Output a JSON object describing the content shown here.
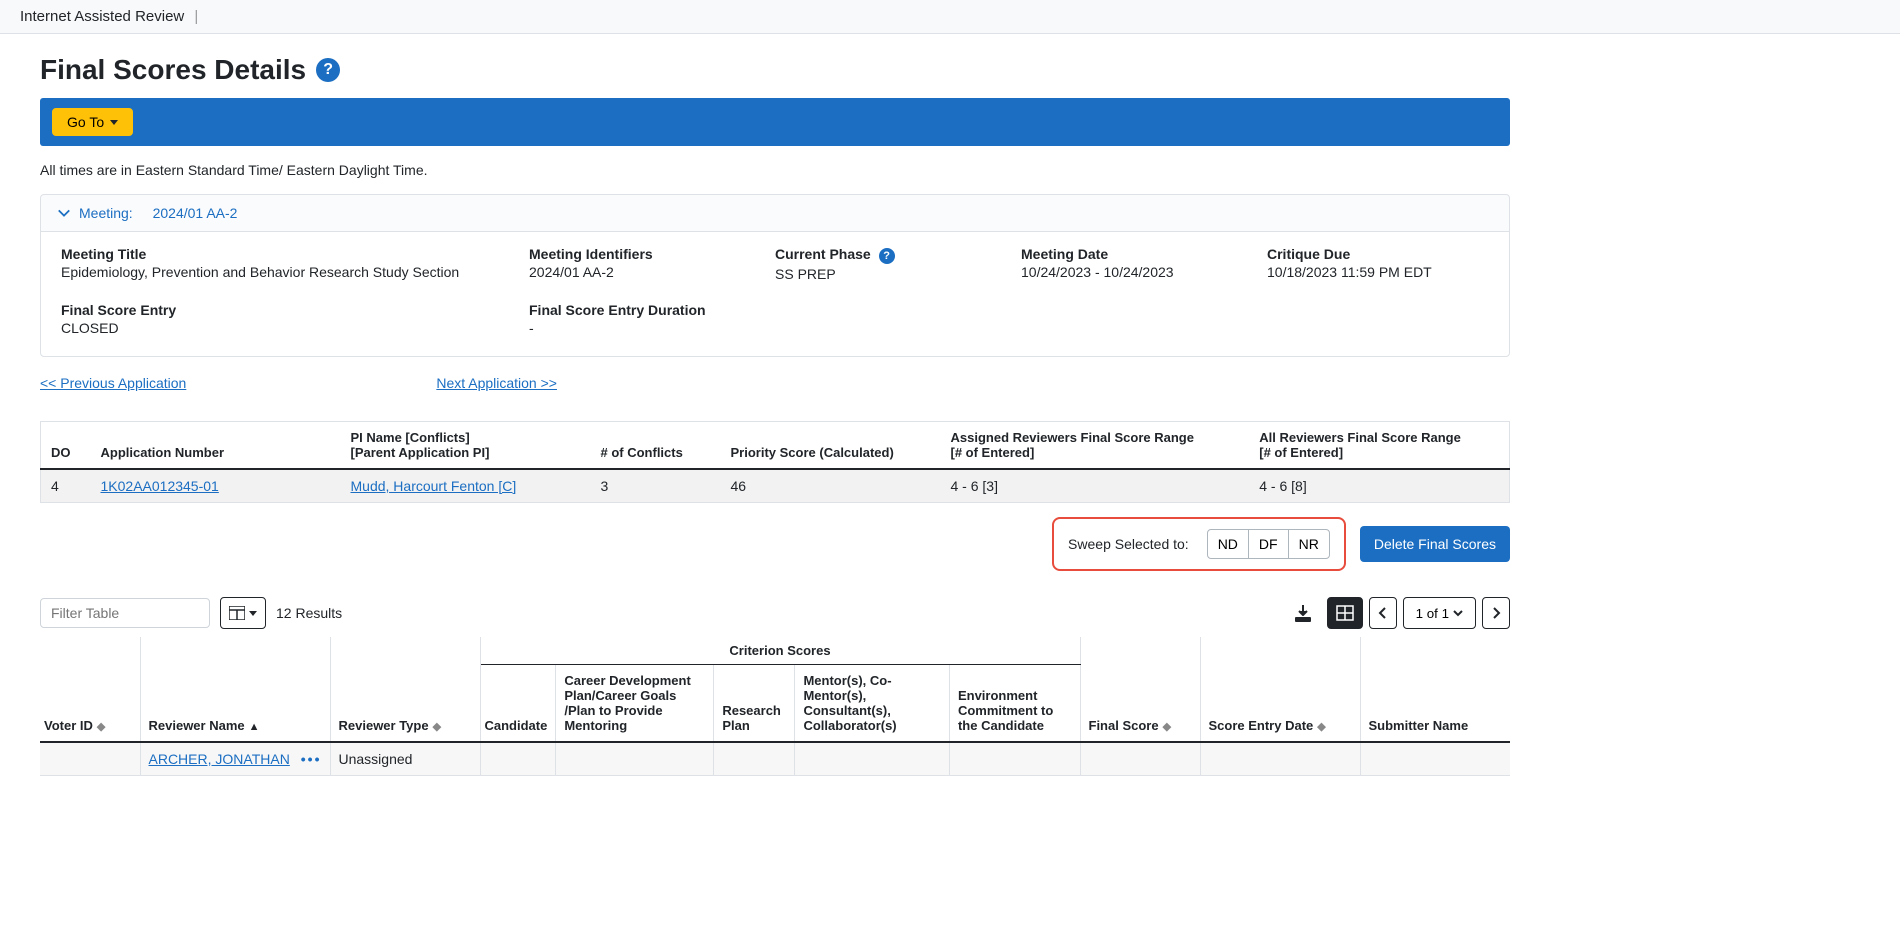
{
  "top_bar": {
    "title": "Internet Assisted Review"
  },
  "page_title": "Final Scores Details",
  "goto_label": "Go To",
  "tz_note": "All times are in Eastern Standard Time/ Eastern Daylight Time.",
  "panel": {
    "header_prefix": "Meeting:",
    "header_value": "2024/01 AA-2"
  },
  "meta": {
    "meeting_title_label": "Meeting Title",
    "meeting_title_value": "Epidemiology, Prevention and Behavior Research Study Section",
    "identifiers_label": "Meeting Identifiers",
    "identifiers_value": "2024/01 AA-2",
    "phase_label": "Current Phase",
    "phase_value": "SS PREP",
    "date_label": "Meeting Date",
    "date_value": "10/24/2023 - 10/24/2023",
    "critique_label": "Critique Due",
    "critique_value": "10/18/2023 11:59 PM EDT",
    "entry_label": "Final Score Entry",
    "entry_value": "CLOSED",
    "duration_label": "Final Score Entry Duration",
    "duration_value": "-"
  },
  "app_nav": {
    "prev": "<< Previous Application",
    "next": "Next Application >>"
  },
  "summary": {
    "headers": {
      "do": "DO",
      "app_num": "Application Number",
      "pi_l1": "PI Name [Conflicts]",
      "pi_l2": "[Parent Application PI]",
      "conflicts": "# of Conflicts",
      "priority": "Priority Score (Calculated)",
      "assigned_l1": "Assigned Reviewers Final Score Range",
      "assigned_l2": "[# of Entered]",
      "all_l1": "All Reviewers Final Score Range",
      "all_l2": "[# of Entered]"
    },
    "row": {
      "do": "4",
      "app_num": "1K02AA012345-01",
      "pi": "Mudd, Harcourt Fenton [C]",
      "conflicts": "3",
      "priority": "46",
      "assigned": "4  -  6  [3]",
      "all": "4 -  6  [8]"
    }
  },
  "sweep": {
    "label": "Sweep Selected to:",
    "nd": "ND",
    "df": "DF",
    "nr": "NR"
  },
  "delete_label": "Delete Final Scores",
  "filter_placeholder": "Filter Table",
  "results_count": "12 Results",
  "pager": {
    "label": "1 of 1"
  },
  "score_headers": {
    "group": "Criterion Scores",
    "voter_id": "Voter ID",
    "reviewer_name": "Reviewer Name",
    "reviewer_type": "Reviewer Type",
    "candidate": "Candidate",
    "career": "Career Development Plan/Career Goals /Plan to Provide Mentoring",
    "research": "Research Plan",
    "mentors": "Mentor(s), Co-Mentor(s), Consultant(s), Collaborator(s)",
    "environment": "Environment Commitment to the Candidate",
    "final_score": "Final Score",
    "entry_date": "Score Entry Date",
    "submitter": "Submitter Name"
  },
  "score_rows": [
    {
      "voter_id": "",
      "reviewer_name": "ARCHER, JONATHAN",
      "reviewer_type": "Unassigned"
    }
  ]
}
